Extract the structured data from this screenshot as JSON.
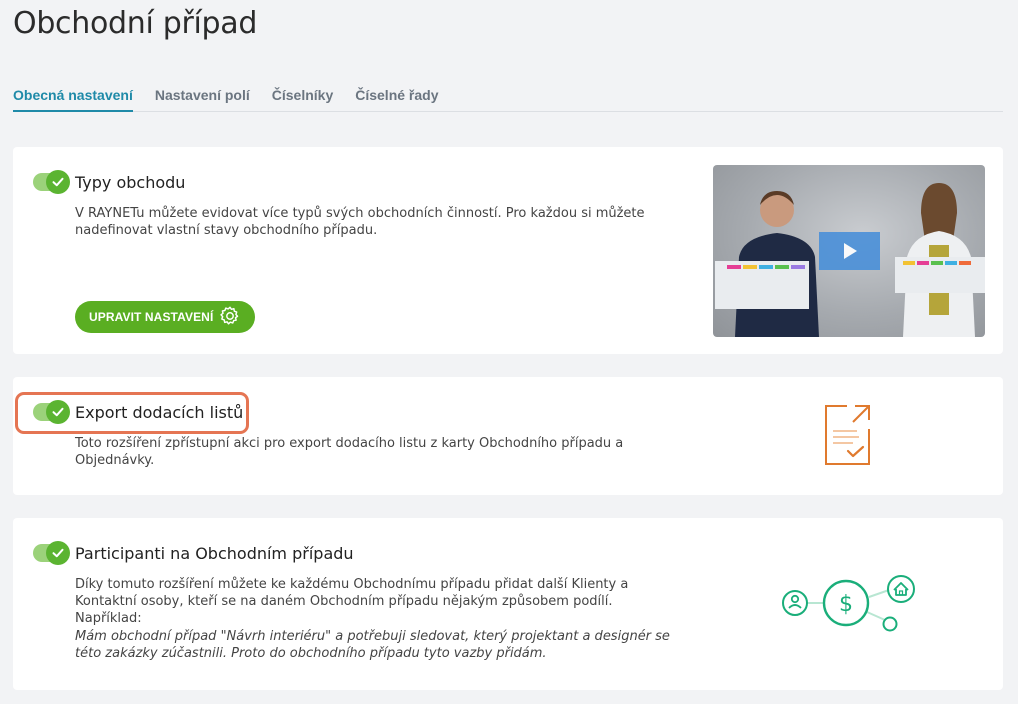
{
  "page": {
    "title": "Obchodní případ"
  },
  "tabs": [
    {
      "label": "Obecná nastavení",
      "active": true
    },
    {
      "label": "Nastavení polí",
      "active": false
    },
    {
      "label": "Číselníky",
      "active": false
    },
    {
      "label": "Číselné řady",
      "active": false
    }
  ],
  "cards": [
    {
      "title": "Typy obchodu",
      "enabled": true,
      "description": "V RAYNETu můžete evidovat více typů svých obchodních činností. Pro každou si můžete nadefinovat vlastní stavy obchodního případu.",
      "button_label": "UPRAVIT NASTAVENÍ",
      "media": "video-thumbnail"
    },
    {
      "title": "Export dodacích listů",
      "enabled": true,
      "description": "Toto rozšíření zpřístupní akci pro export dodacího listu z karty Obchodního případu a Objednávky.",
      "media": "document-export-icon"
    },
    {
      "title": "Participanti na Obchodním případu",
      "enabled": true,
      "description": "Díky tomuto rozšíření můžete ke každému Obchodnímu případu přidat další Klienty a Kontaktní osoby, kteří se na daném Obchodním případu nějakým způsobem podílí. Například:",
      "example": "Mám obchodní případ \"Návrh interiéru\" a potřebuji sledovat, který projektant a designér se této zakázky zúčastnili. Proto do obchodního případu tyto vazby přidám.",
      "media": "participants-network-icon"
    }
  ],
  "colors": {
    "accent_tab": "#1f8aa8",
    "toggle_on": "#5bb431",
    "button_green": "#5aae22",
    "highlight": "#e57553",
    "icon_orange": "#e07a2e",
    "icon_teal": "#1aae7a"
  }
}
